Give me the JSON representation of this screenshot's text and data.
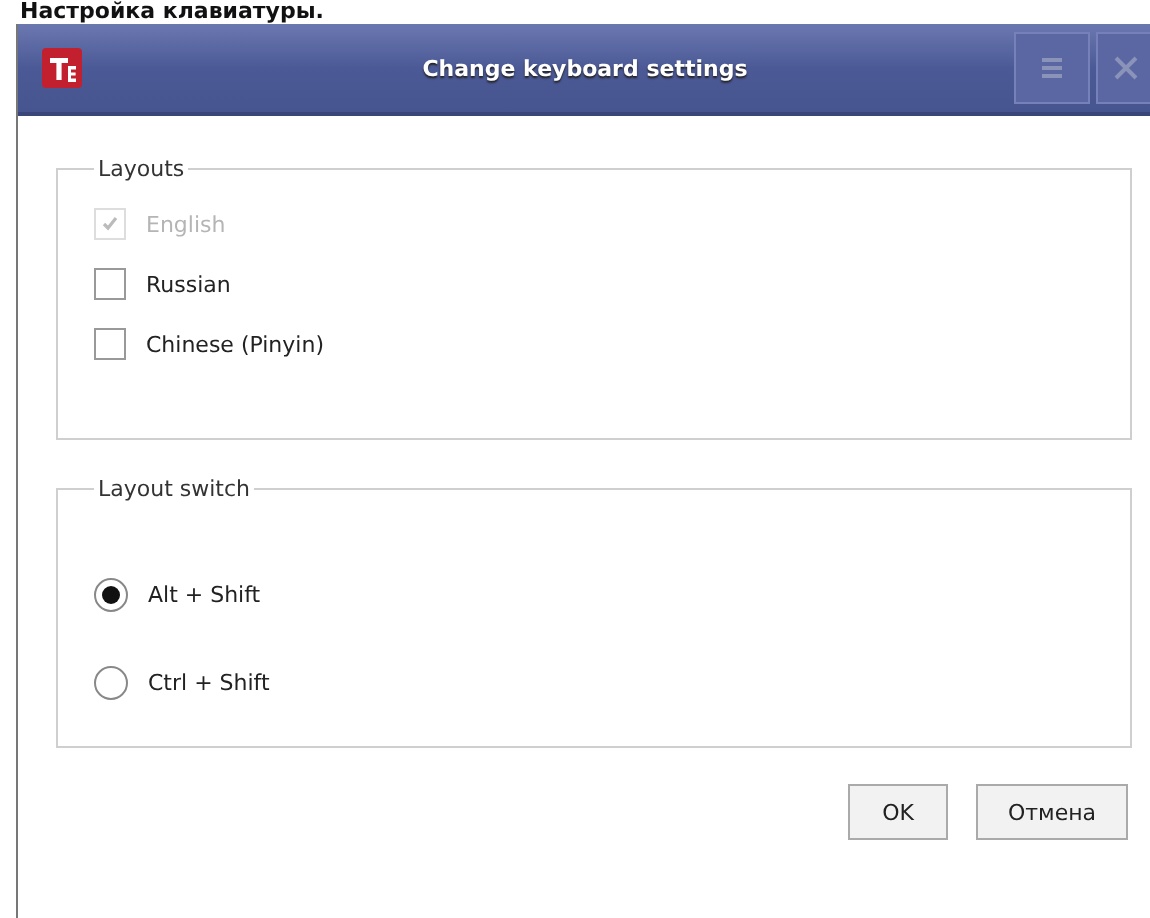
{
  "heading": "Настройка клавиатуры.",
  "window": {
    "title": "Change keyboard settings"
  },
  "groups": [
    {
      "title": "Layouts",
      "kind": "checkbox",
      "items": [
        {
          "label": "English",
          "checked": true,
          "disabled": true
        },
        {
          "label": "Russian",
          "checked": false,
          "disabled": false
        },
        {
          "label": "Chinese (Pinyin)",
          "checked": false,
          "disabled": false
        }
      ]
    },
    {
      "title": "Layout switch",
      "kind": "radio",
      "items": [
        {
          "label": "Alt + Shift",
          "selected": true
        },
        {
          "label": "Ctrl + Shift",
          "selected": false
        }
      ]
    }
  ],
  "buttons": [
    "OK",
    "Отмена"
  ]
}
